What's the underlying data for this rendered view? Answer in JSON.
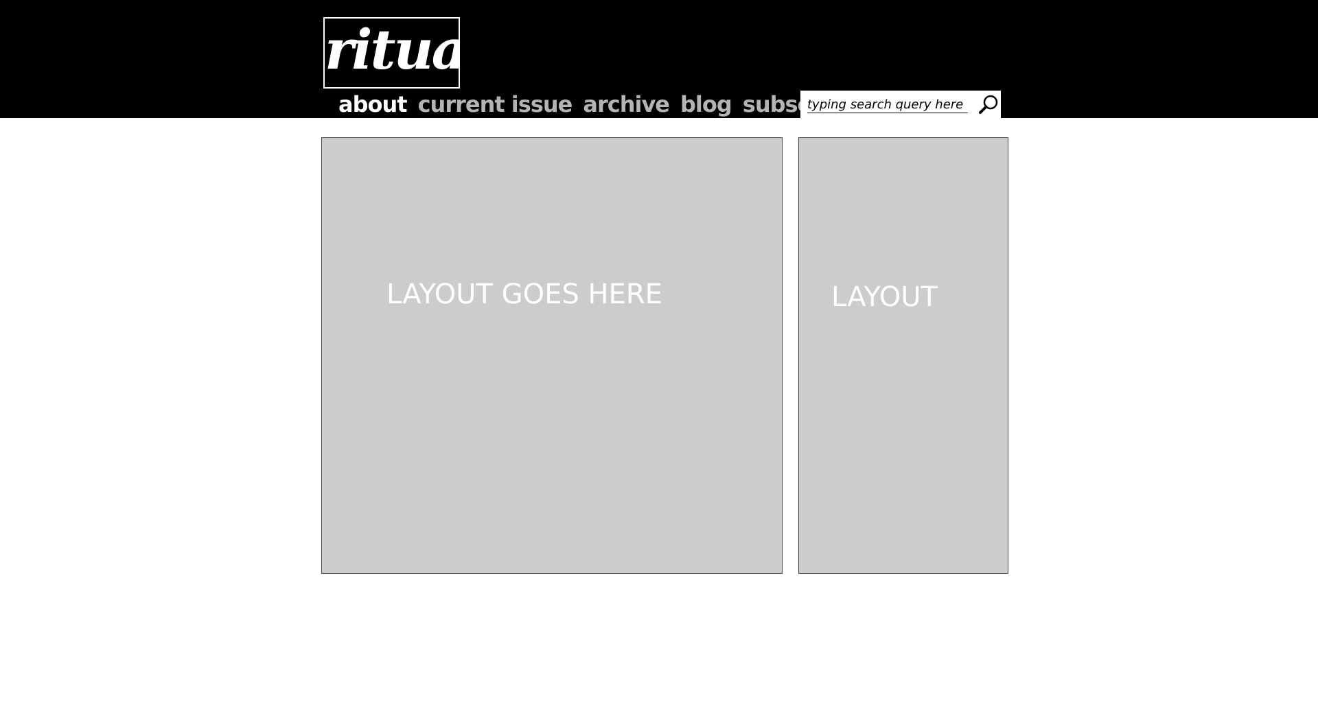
{
  "header": {
    "logo_text": "ritual"
  },
  "nav": {
    "items": [
      {
        "label": "about",
        "active": true
      },
      {
        "label": "current issue",
        "active": false
      },
      {
        "label": "archive",
        "active": false
      },
      {
        "label": "blog",
        "active": false
      },
      {
        "label": "subscribe",
        "active": false
      }
    ]
  },
  "search": {
    "placeholder": "typing search query here",
    "icon": "search-icon"
  },
  "main_panel": {
    "label": "LAYOUT GOES HERE"
  },
  "side_panel": {
    "label": "LAYOUT"
  },
  "colors": {
    "header_bg": "#000000",
    "nav_active": "#ffffff",
    "nav_inactive": "#b4b4b4",
    "panel_bg": "#cccccc",
    "panel_border": "#444444"
  }
}
